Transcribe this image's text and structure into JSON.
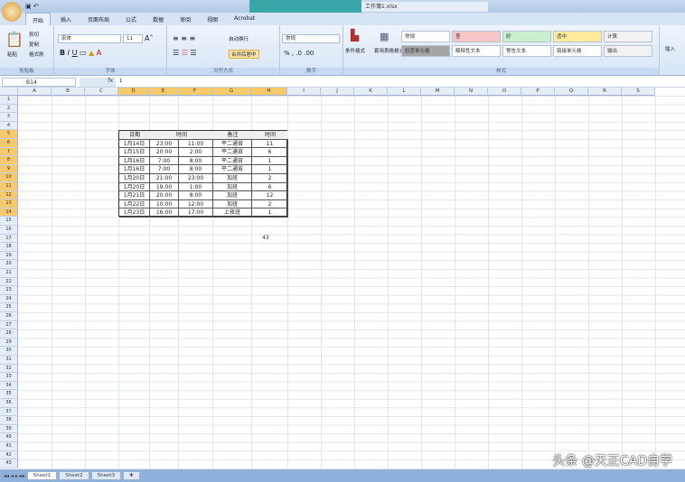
{
  "window": {
    "title": "Microsoft Excel",
    "document": "工作簿1.xlsx"
  },
  "quick_access": [
    "保存",
    "撤销"
  ],
  "tabs": [
    "开始",
    "插入",
    "页面布局",
    "公式",
    "数据",
    "审阅",
    "视图",
    "Acrobat"
  ],
  "clipboard": {
    "paste": "粘贴",
    "cut": "剪切",
    "copy": "复制",
    "format_painter": "格式刷",
    "group": "剪贴板"
  },
  "font": {
    "name": "宋体",
    "size": "11",
    "group": "字体"
  },
  "alignment": {
    "wrap": "自动换行",
    "merge": "合并后居中",
    "group": "对齐方式"
  },
  "number": {
    "format": "常规",
    "group": "数字"
  },
  "styles": {
    "conditional": "条件格式",
    "table_format": "套用表格格式",
    "group": "样式",
    "items": [
      {
        "label": "常规",
        "bg": "#ffffff"
      },
      {
        "label": "差",
        "bg": "#f7c6c6"
      },
      {
        "label": "好",
        "bg": "#c9efce"
      },
      {
        "label": "适中",
        "bg": "#ffeb9c"
      },
      {
        "label": "计算",
        "bg": "#f2f2f2"
      },
      {
        "label": "检查单元格",
        "bg": "#a5a5a5"
      },
      {
        "label": "解释性文本",
        "bg": "#ffffff"
      },
      {
        "label": "警告文本",
        "bg": "#ffffff"
      },
      {
        "label": "链接单元格",
        "bg": "#ffffff"
      },
      {
        "label": "输出",
        "bg": "#f2f2f2"
      }
    ]
  },
  "cells_group": {
    "insert": "插入"
  },
  "formula_bar": {
    "name_box": "B14",
    "fx": "fx",
    "content": "1"
  },
  "columns": [
    "A",
    "B",
    "C",
    "D",
    "E",
    "F",
    "G",
    "H",
    "I",
    "J",
    "K",
    "L",
    "M",
    "N",
    "O",
    "P",
    "Q",
    "R",
    "S"
  ],
  "selected_columns": [
    "D",
    "E",
    "F",
    "G",
    "H"
  ],
  "table": {
    "headers": [
      "日期",
      "时间",
      "备注",
      "时间"
    ],
    "rows": [
      [
        "1月14日",
        "23:00",
        "11:00",
        "平二通宵",
        "11"
      ],
      [
        "1月15日",
        "20:00",
        "2:00",
        "平二通宵",
        "6"
      ],
      [
        "1月16日",
        "7:00",
        "8:00",
        "平二通宵",
        "1"
      ],
      [
        "1月16日",
        "7:00",
        "8:00",
        "平二通宵",
        "1"
      ],
      [
        "1月20日",
        "21:00",
        "23:00",
        "加班",
        "2"
      ],
      [
        "1月20日",
        "19:00",
        "1:00",
        "加班",
        "6"
      ],
      [
        "1月21日",
        "20:00",
        "8:00",
        "加班",
        "12"
      ],
      [
        "1月22日",
        "10:00",
        "12:00",
        "加班",
        "2"
      ],
      [
        "1月23日",
        "16:00",
        "17:00",
        "上夜班",
        "1"
      ]
    ]
  },
  "sum": "43",
  "sheets": [
    "Sheet1",
    "Sheet2",
    "Sheet3"
  ],
  "watermark": "头条 @天正CAD自学"
}
